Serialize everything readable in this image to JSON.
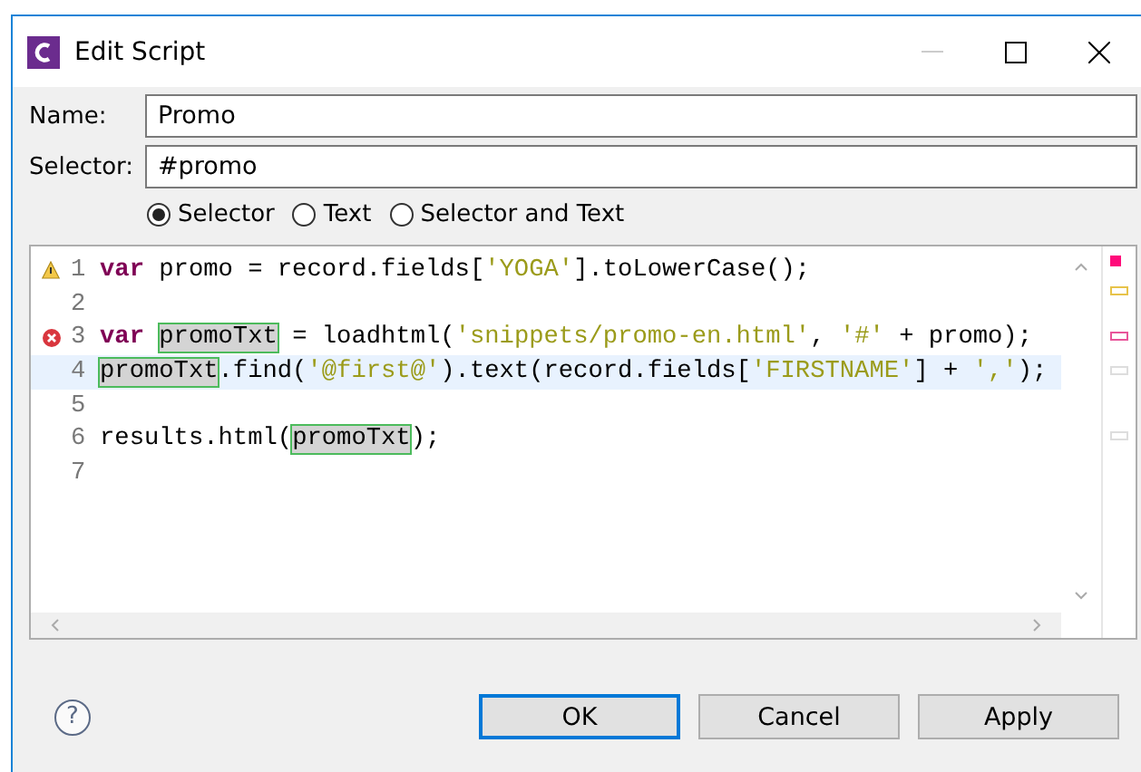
{
  "window": {
    "title": "Edit Script"
  },
  "fields": [
    {
      "label": "Name:",
      "value": "Promo"
    },
    {
      "label": "Selector:",
      "value": "#promo"
    }
  ],
  "options": [
    {
      "label": "Selector",
      "selected": true
    },
    {
      "label": "Text",
      "selected": false
    },
    {
      "label": "Selector and Text",
      "selected": false
    }
  ],
  "editor": {
    "lines": [
      {
        "number": "1",
        "warning": true,
        "error": false,
        "current": false,
        "tokens": [
          {
            "kind": "keyword",
            "text": "var"
          },
          {
            "kind": "plain",
            "text": " promo = record.fields["
          },
          {
            "kind": "string",
            "text": "'YOGA'"
          },
          {
            "kind": "plain",
            "text": "].toLowerCase();"
          }
        ]
      },
      {
        "number": "2",
        "warning": false,
        "error": false,
        "current": false
      },
      {
        "number": "3",
        "warning": false,
        "error": true,
        "current": false,
        "tokens": [
          {
            "kind": "keyword",
            "text": "var "
          },
          {
            "kind": "occurrence",
            "text": "promoTxt"
          },
          {
            "kind": "plain",
            "text": " = loadhtml("
          },
          {
            "kind": "string",
            "text": "'snippets/promo-en.html'"
          },
          {
            "kind": "plain",
            "text": ", "
          },
          {
            "kind": "string",
            "text": "'#'"
          },
          {
            "kind": "plain",
            "text": " + promo);"
          }
        ]
      },
      {
        "number": "4",
        "warning": false,
        "error": false,
        "current": true,
        "tokens": [
          {
            "kind": "occurrence",
            "text": "promoTxt"
          },
          {
            "kind": "plain",
            "text": ".find("
          },
          {
            "kind": "string",
            "text": "'@first@'"
          },
          {
            "kind": "plain",
            "text": ").text(record.fields["
          },
          {
            "kind": "string",
            "text": "'FIRSTNAME'"
          },
          {
            "kind": "plain",
            "text": "] + "
          },
          {
            "kind": "string",
            "text": "','"
          },
          {
            "kind": "plain",
            "text": ");"
          }
        ]
      },
      {
        "number": "5",
        "warning": false,
        "error": false,
        "current": false
      },
      {
        "number": "6",
        "warning": false,
        "error": false,
        "current": false,
        "tokens": [
          {
            "kind": "plain",
            "text": "results.html"
          },
          {
            "kind": "bracket",
            "text": "("
          },
          {
            "kind": "occurrence",
            "text": "promoTxt"
          },
          {
            "kind": "bracket",
            "text": ")"
          },
          {
            "kind": "plain",
            "text": ";"
          }
        ]
      },
      {
        "number": "7",
        "warning": false,
        "error": false,
        "current": false
      }
    ]
  },
  "help": "?",
  "buttons": [
    {
      "label": "OK",
      "default": true
    },
    {
      "label": "Cancel",
      "default": false
    },
    {
      "label": "Apply",
      "default": false
    }
  ]
}
